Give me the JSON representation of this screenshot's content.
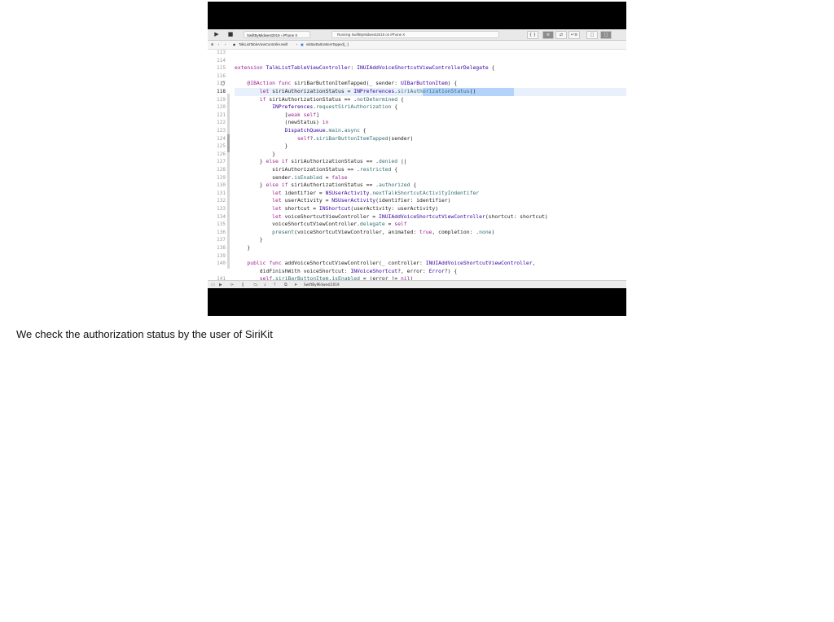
{
  "window": {
    "toolbar": {
      "run_icon": "play-icon",
      "stop_icon": "stop-icon",
      "scheme_label": "SwiftByMidwest2019 › iPhone X",
      "activity_text": "Running SwiftByMidwest2019 on iPhone X",
      "segments": [
        "{ }",
        "≡",
        "⇄",
        "↵≡",
        "□",
        "□"
      ]
    },
    "jumpbar": {
      "file": "TalkListTableViewController.swift",
      "method": "siriBarButtonItemTapped(_:)"
    },
    "editor": {
      "current_line": "118",
      "lines": [
        {
          "n": "113",
          "html": ""
        },
        {
          "n": "114",
          "html": ""
        },
        {
          "n": "115",
          "html": "<span class=\"k\">extension</span> <span class=\"t\">TalkListTableViewController</span>: <span class=\"t\">INUIAddVoiceShortcutViewControllerDelegate</span> {"
        },
        {
          "n": "116",
          "html": ""
        },
        {
          "n": "117",
          "html": "    <span class=\"k\">@IBAction</span> <span class=\"k\">func</span> siriBarButtonItemTapped(_ sender: <span class=\"t\">UIBarButtonItem</span>) {"
        },
        {
          "n": "118",
          "html": "        <span class=\"k\">let</span> siriAuthorizationStatus = <span class=\"t\">INPreferences</span>.<span class=\"m\">siriAuthorizationStatus</span>()"
        },
        {
          "n": "119",
          "html": "        <span class=\"k\">if</span> siriAuthorizationStatus == .<span class=\"m\">notDetermined</span> {"
        },
        {
          "n": "120",
          "html": "            <span class=\"t\">INPreferences</span>.<span class=\"m\">requestSiriAuthorization</span> {"
        },
        {
          "n": "121",
          "html": "                [<span class=\"k\">weak</span> <span class=\"k\">self</span>]"
        },
        {
          "n": "122",
          "html": "                (newStatus) <span class=\"k\">in</span>"
        },
        {
          "n": "123",
          "html": "                <span class=\"t\">DispatchQueue</span>.<span class=\"m\">main</span>.<span class=\"m\">async</span> {"
        },
        {
          "n": "124",
          "html": "                    <span class=\"k\">self</span>?.<span class=\"m\">siriBarButtonItemTapped</span>(sender)"
        },
        {
          "n": "125",
          "html": "                }"
        },
        {
          "n": "126",
          "html": "            }"
        },
        {
          "n": "127",
          "html": "        } <span class=\"k\">else</span> <span class=\"k\">if</span> siriAuthorizationStatus == .<span class=\"m\">denied</span> ||"
        },
        {
          "n": "128",
          "html": "            siriAuthorizationStatus == .<span class=\"m\">restricted</span> {"
        },
        {
          "n": "129",
          "html": "            sender.<span class=\"m\">isEnabled</span> = <span class=\"k\">false</span>"
        },
        {
          "n": "130",
          "html": "        } <span class=\"k\">else</span> <span class=\"k\">if</span> siriAuthorizationStatus == .<span class=\"m\">authorized</span> {"
        },
        {
          "n": "131",
          "html": "            <span class=\"k\">let</span> identifier = <span class=\"t\">NSUserActivity</span>.<span class=\"m\">nextTalkShortcutActivityIndentifer</span>"
        },
        {
          "n": "132",
          "html": "            <span class=\"k\">let</span> userActivity = <span class=\"t\">NSUserActivity</span>(identifier: identifier)"
        },
        {
          "n": "133",
          "html": "            <span class=\"k\">let</span> shortcut = <span class=\"t\">INShortcut</span>(userActivity: userActivity)"
        },
        {
          "n": "134",
          "html": "            <span class=\"k\">let</span> voiceShortcutViewController = <span class=\"t\">INUIAddVoiceShortcutViewController</span>(shortcut: shortcut)"
        },
        {
          "n": "135",
          "html": "            voiceShortcutViewController.<span class=\"m\">delegate</span> = <span class=\"k\">self</span>"
        },
        {
          "n": "136",
          "html": "            <span class=\"m\">present</span>(voiceShortcutViewController, animated: <span class=\"k\">true</span>, completion: .<span class=\"m\">none</span>)"
        },
        {
          "n": "137",
          "html": "        }"
        },
        {
          "n": "138",
          "html": "    }"
        },
        {
          "n": "139",
          "html": ""
        },
        {
          "n": "140",
          "html": "    <span class=\"k\">public</span> <span class=\"k\">func</span> addVoiceShortcutViewController(_ controller: <span class=\"t\">INUIAddVoiceShortcutViewController</span>,"
        },
        {
          "n": "",
          "html": "        didFinishWith voiceShortcut: <span class=\"t\">INVoiceShortcut</span>?, error: <span class=\"t\">Error</span>?) {"
        },
        {
          "n": "141",
          "html": "        <span class=\"k\">self</span>.<span class=\"m\">siriBarButtonItem</span>.<span class=\"m\">isEnabled</span> = (error != <span class=\"k\">nil</span>)"
        }
      ]
    },
    "debugbar": {
      "target_label": "SwiftByMidwest2019"
    }
  },
  "caption": "We check the authorization status by the user of SiriKit"
}
